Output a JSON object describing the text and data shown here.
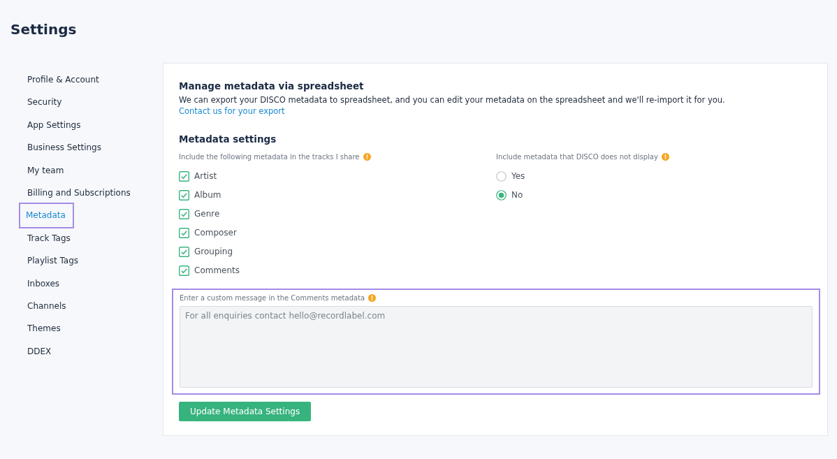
{
  "page_title": "Settings",
  "sidebar": {
    "items": [
      {
        "label": "Profile & Account",
        "selected": false
      },
      {
        "label": "Security",
        "selected": false
      },
      {
        "label": "App Settings",
        "selected": false
      },
      {
        "label": "Business Settings",
        "selected": false
      },
      {
        "label": "My team",
        "selected": false
      },
      {
        "label": "Billing and Subscriptions",
        "selected": false
      },
      {
        "label": "Metadata",
        "selected": true
      },
      {
        "label": "Track Tags",
        "selected": false
      },
      {
        "label": "Playlist Tags",
        "selected": false
      },
      {
        "label": "Inboxes",
        "selected": false
      },
      {
        "label": "Channels",
        "selected": false
      },
      {
        "label": "Themes",
        "selected": false
      },
      {
        "label": "DDEX",
        "selected": false
      }
    ]
  },
  "spreadsheet": {
    "heading": "Manage metadata via spreadsheet",
    "text": "We can export your DISCO metadata to spreadsheet, and you can edit your metadata on the spreadsheet and we'll re-import it for you.",
    "link": "Contact us for your export"
  },
  "metadata_settings": {
    "heading": "Metadata settings",
    "include_label": "Include the following metadata in the tracks I share",
    "fields": [
      {
        "label": "Artist",
        "checked": true
      },
      {
        "label": "Album",
        "checked": true
      },
      {
        "label": "Genre",
        "checked": true
      },
      {
        "label": "Composer",
        "checked": true
      },
      {
        "label": "Grouping",
        "checked": true
      },
      {
        "label": "Comments",
        "checked": true
      }
    ],
    "extra_label": "Include metadata that DISCO does not display",
    "extra_options": [
      {
        "label": "Yes",
        "selected": false
      },
      {
        "label": "No",
        "selected": true
      }
    ],
    "comment": {
      "label": "Enter a custom message in the Comments metadata",
      "placeholder": "For all enquiries contact hello@recordlabel.com",
      "highlighted": true
    },
    "button": "Update Metadata Settings"
  }
}
